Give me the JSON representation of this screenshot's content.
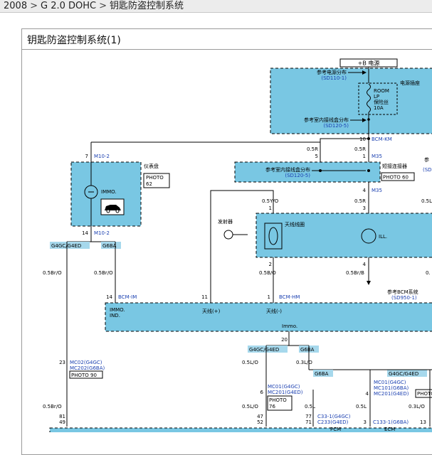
{
  "breadcrumb": {
    "parts": [
      "2008",
      "G 2.0 DOHC",
      "钥匙防盗控制系统"
    ]
  },
  "diagram": {
    "title": "钥匙防盗控制系统(1)",
    "power": {
      "label": "+B 电源"
    },
    "fuse_box": {
      "ref1": "参考电源分布",
      "ref1_code": "(SD110-1)",
      "ref2": "参考室内接线盒分布",
      "ref2_code": "(SD120-5)",
      "name": "电源插座",
      "fuse_line1": "ROOM",
      "fuse_line2": "LP",
      "fuse_line3": "保险丝",
      "fuse_line4": "10A"
    },
    "pins": {
      "p10": "10",
      "bcmkm": "BCM-KM",
      "p05r_a": "0.5R",
      "p05r_b": "0.5R",
      "p5": "5",
      "p1": "1",
      "m35": "M35",
      "m35b": "M35",
      "p4": "4",
      "p05r_c": "0.5R",
      "p3": "3",
      "p05yo": "0.5Y/O",
      "p1b": "1",
      "p2": "2",
      "p4b": "4",
      "p05bo": "0.5B/O",
      "p05brb": "0.5Br/B",
      "p7": "7",
      "m10_2": "M10-2",
      "p14": "14",
      "m10_2b": "M10-2",
      "p05lo_r": "0.5L/O",
      "p0_r": "0."
    },
    "joint": {
      "ref": "参考室内接线盒分布",
      "ref_code": "(SD120-5)",
      "name": "短接连接器",
      "photo": "PHOTO 60",
      "side_ref": "参",
      "side_code": "(SD"
    },
    "cluster": {
      "name": "仪表盘",
      "photo1": "PHOTO",
      "photo2": "62",
      "immo": "IMMO."
    },
    "coil": {
      "transmitter": "发射器",
      "coil_name": "天线线圈",
      "ill": "ILL."
    },
    "ref_bcm": {
      "text": "参考BCM系统",
      "code": "(SD950-1)"
    },
    "engine_tags": {
      "left_a": "G4GC/G4ED",
      "left_b": "G6BA",
      "mid_a": "G4GC/G4ED",
      "mid_b": "G6BA",
      "low_g6ba": "G6BA",
      "low_g4": "G4GC/G4ED"
    },
    "wires": {
      "w05bro_l": "0.5Br/O",
      "w05bro_r": "0.5Br/O",
      "w05lo_a": "0.5L/O",
      "w03lo_a": "0.3L/O",
      "w05lo_b": "0.5L/O",
      "w05l": "0.5L",
      "w05l_b": "0.5L",
      "w03lo_b": "0.3L/O",
      "w05bro_low": "0.5Br/O"
    },
    "bcm": {
      "p14": "14",
      "bcm_im": "BCM-IM",
      "p11": "11",
      "p1": "1",
      "bcm_hm": "BCM-HM",
      "immo_ind1": "IMMO.",
      "immo_ind2": "IND.",
      "ant_pos": "天线(+)",
      "ant_neg": "天线(-)",
      "immo": "Immo.",
      "p20": "20"
    },
    "connectors": {
      "p23": "23",
      "mc02": "MC02(G4GC)",
      "mc202": "MC202(G6BA)",
      "photo90": "PHOTO 90",
      "p81": "81",
      "p49": "49",
      "p6": "6",
      "mc01a": "MC01(G4GC)",
      "mc201a": "MC201(G4ED)",
      "photo76a": "PHOTO",
      "photo76b": "76",
      "p47": "47",
      "p52": "52",
      "p77": "77",
      "p71": "71",
      "c33": "C33-1(G4GC)",
      "c233": "C233(G4ED)",
      "pcm": "PCM",
      "p4": "4",
      "mc01b": "MC01(G4GC)",
      "mc101": "MC101(G6BA)",
      "mc201b": "MC201(G4ED)",
      "photo_r": "PHOTO",
      "p3": "3",
      "c133": "C133-1(G6BA)",
      "p13": "13",
      "ecm": "ECM"
    }
  },
  "colors": {
    "module_fill": "#79c7e3",
    "tag_fill": "#a6d8ec",
    "blue_text": "#1a3fb0",
    "line": "#000000"
  }
}
